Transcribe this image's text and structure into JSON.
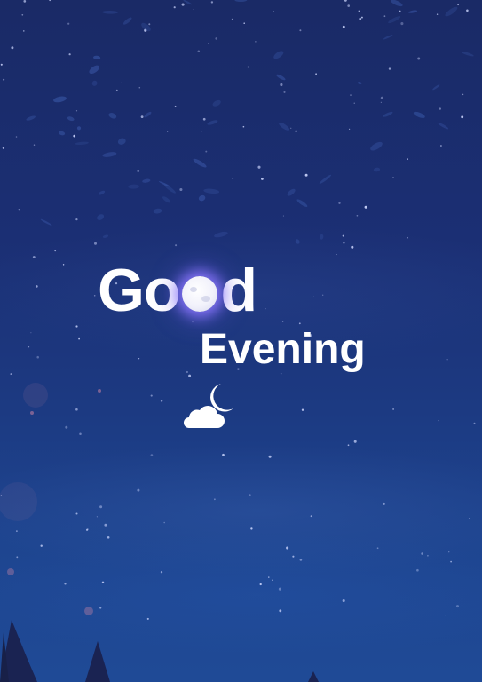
{
  "greeting": {
    "word1_start": "Go",
    "word1_end": "d",
    "word2": "Evening"
  },
  "icons": {
    "moon_letter": "full-moon-icon",
    "weather": "cloud-moon-icon"
  },
  "colors": {
    "sky_top": "#1a2a66",
    "sky_bottom": "#1f4a96",
    "text": "#ffffff",
    "moon_glow": "#8c78ff",
    "tree": "#1a2352"
  }
}
